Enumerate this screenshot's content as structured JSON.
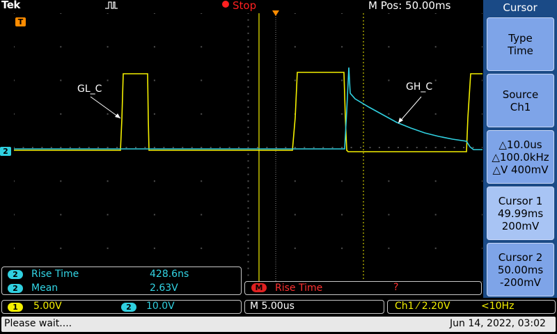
{
  "topbar": {
    "brand": "Tek",
    "run_state": "Stop",
    "m_pos": "M Pos: 50.00ms"
  },
  "annotations": {
    "gl": "GL_C",
    "gh": "GH_C"
  },
  "markers": {
    "trigger": "T",
    "ch2": "2"
  },
  "menu": {
    "title": "Cursor",
    "buttons": [
      {
        "lines": [
          "Type",
          "Time"
        ]
      },
      {
        "lines": [
          "Source",
          "Ch1"
        ]
      },
      {
        "lines": [
          "△10.0us",
          "△100.0kHz",
          "△V 400mV"
        ]
      },
      {
        "lines": [
          "Cursor 1",
          "49.99ms",
          "200mV"
        ]
      },
      {
        "lines": [
          "Cursor 2",
          "50.00ms",
          "-200mV"
        ]
      }
    ]
  },
  "measurements": [
    {
      "channel": "2",
      "name": "Rise Time",
      "value": "428.6ns"
    },
    {
      "channel": "2",
      "name": "Mean",
      "value": "2.63V"
    }
  ],
  "math": {
    "badge": "M",
    "name": "Rise Time",
    "value": "?"
  },
  "bottom": {
    "ch1_badge": "1",
    "ch1_scale": "5.00V",
    "ch2_badge": "2",
    "ch2_scale": "10.0V",
    "timebase": "M 5.00us",
    "trigger": "Ch1 ⁄ 2.20V",
    "trigger_freq": "<10Hz",
    "status": "Please wait....",
    "datetime": "Jun 14, 2022, 03:02"
  },
  "colors": {
    "ch1": "#f4f000",
    "ch2": "#30d0e0",
    "menu_bg": "#1a4a86",
    "menu_button": "#7ea4e8",
    "stop": "#ff2020",
    "trigger_marker": "#ff8c00"
  }
}
